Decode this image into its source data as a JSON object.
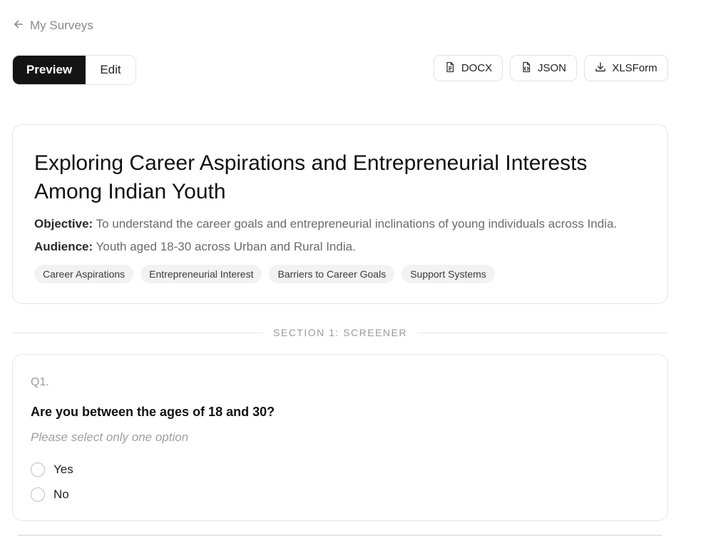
{
  "nav": {
    "back_label": "My Surveys",
    "back_icon": "arrow-left-icon"
  },
  "toolbar": {
    "mode_tabs": [
      {
        "label": "Preview",
        "active": true
      },
      {
        "label": "Edit",
        "active": false
      }
    ],
    "exports": [
      {
        "label": "DOCX",
        "icon": "document-icon"
      },
      {
        "label": "JSON",
        "icon": "json-file-icon"
      },
      {
        "label": "XLSForm",
        "icon": "download-icon"
      }
    ]
  },
  "survey": {
    "title": "Exploring Career Aspirations and Entrepreneurial Interests Among Indian Youth",
    "objective_label": "Objective:",
    "objective_text": "To understand the career goals and entrepreneurial inclinations of young individuals across India.",
    "audience_label": "Audience:",
    "audience_text": "Youth aged 18-30 across Urban and Rural India.",
    "tags": [
      "Career Aspirations",
      "Entrepreneurial Interest",
      "Barriers to Career Goals",
      "Support Systems"
    ]
  },
  "sections": [
    {
      "label": "SECTION 1: SCREENER",
      "questions": [
        {
          "number": "Q1.",
          "text": "Are you between the ages of 18 and 30?",
          "hint": "Please select only one option",
          "options": [
            "Yes",
            "No"
          ]
        }
      ]
    }
  ],
  "colors": {
    "accent_dark": "#141414",
    "border": "#e6e6e6",
    "tag_bg": "#f1f2f4",
    "muted_text": "#9a9a9a"
  }
}
